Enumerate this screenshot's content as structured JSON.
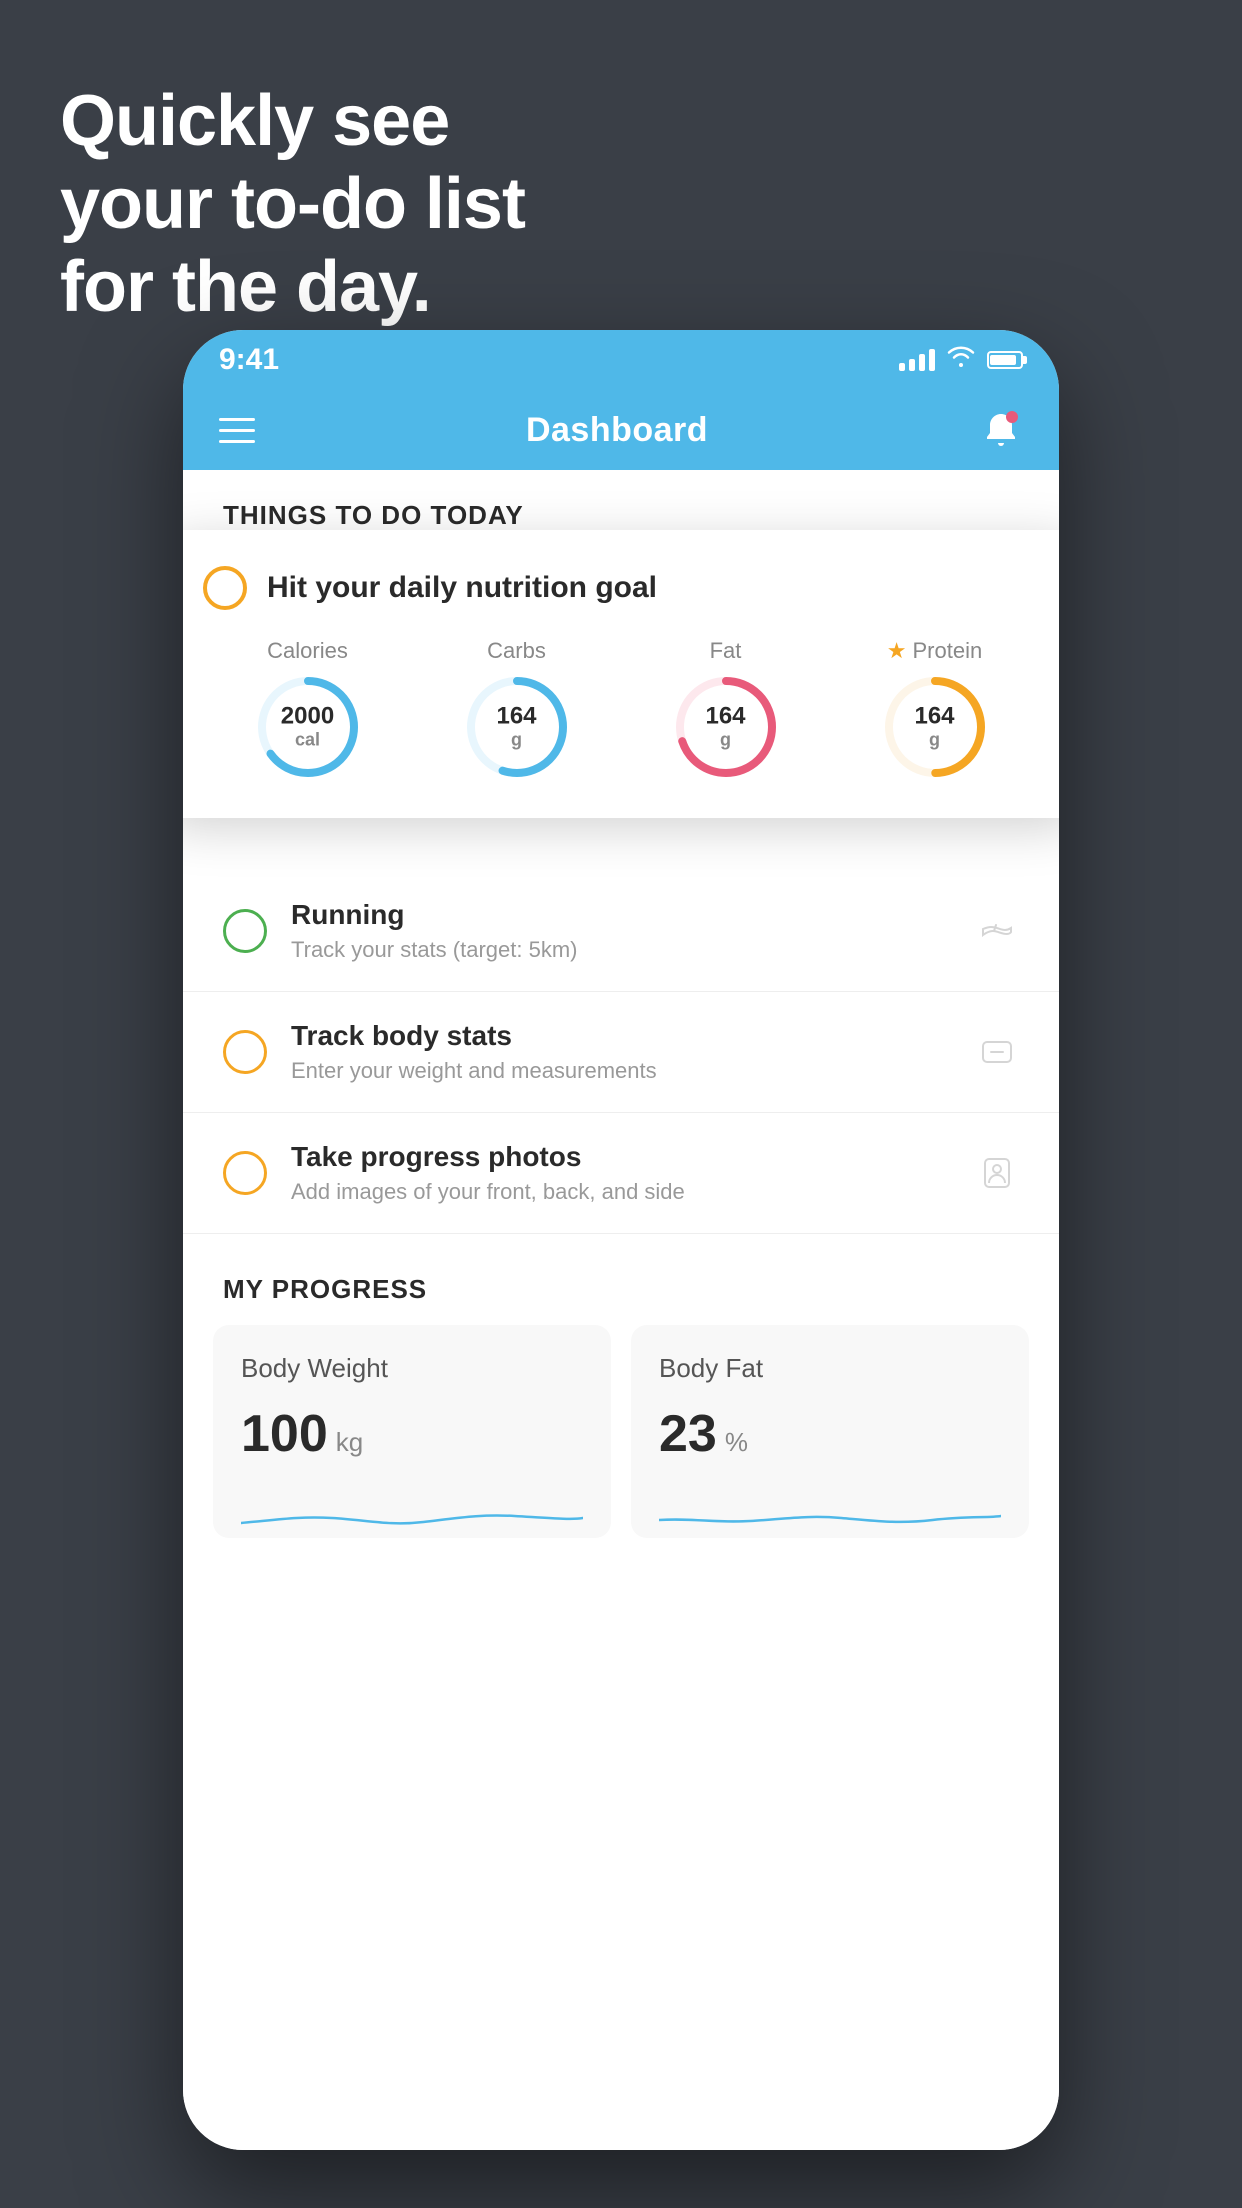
{
  "headline": {
    "line1": "Quickly see",
    "line2": "your to-do list",
    "line3": "for the day."
  },
  "phone": {
    "statusBar": {
      "time": "9:41"
    },
    "navBar": {
      "title": "Dashboard"
    },
    "sectionHeader": "THINGS TO DO TODAY",
    "floatingCard": {
      "title": "Hit your daily nutrition goal",
      "nutrition": [
        {
          "label": "Calories",
          "value": "2000",
          "unit": "cal",
          "color": "#4fb8e8",
          "bgColor": "#e8f6fd",
          "percent": 65,
          "star": false
        },
        {
          "label": "Carbs",
          "value": "164",
          "unit": "g",
          "color": "#4fb8e8",
          "bgColor": "#e8f6fd",
          "percent": 55,
          "star": false
        },
        {
          "label": "Fat",
          "value": "164",
          "unit": "g",
          "color": "#e85a7a",
          "bgColor": "#fde8ed",
          "percent": 70,
          "star": false
        },
        {
          "label": "Protein",
          "value": "164",
          "unit": "g",
          "color": "#f5a623",
          "bgColor": "#fdf5e8",
          "percent": 50,
          "star": true
        }
      ]
    },
    "todoItems": [
      {
        "title": "Running",
        "subtitle": "Track your stats (target: 5km)",
        "circleColor": "green",
        "icon": "shoe"
      },
      {
        "title": "Track body stats",
        "subtitle": "Enter your weight and measurements",
        "circleColor": "yellow",
        "icon": "scale"
      },
      {
        "title": "Take progress photos",
        "subtitle": "Add images of your front, back, and side",
        "circleColor": "yellow",
        "icon": "person"
      }
    ],
    "progressSection": {
      "header": "MY PROGRESS",
      "cards": [
        {
          "title": "Body Weight",
          "value": "100",
          "unit": "kg"
        },
        {
          "title": "Body Fat",
          "value": "23",
          "unit": "%"
        }
      ]
    }
  }
}
